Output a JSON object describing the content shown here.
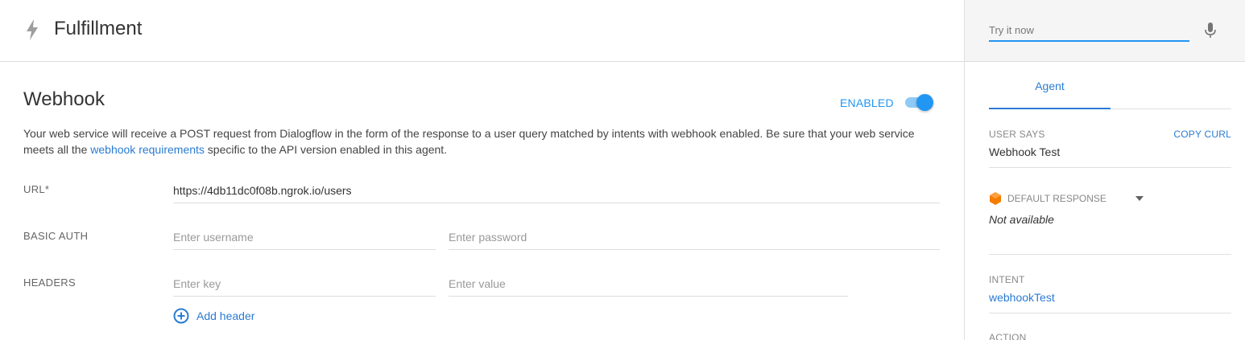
{
  "header": {
    "title": "Fulfillment"
  },
  "webhook": {
    "title": "Webhook",
    "enabled_label": "ENABLED",
    "enabled": true,
    "description_before": "Your web service will receive a POST request from Dialogflow in the form of the response to a user query matched by intents with webhook enabled. Be sure that your web service meets all the ",
    "description_link": "webhook requirements",
    "description_after": " specific to the API version enabled in this agent.",
    "url_label": "URL*",
    "url_value": "https://4db11dc0f08b.ngrok.io/users",
    "basic_auth_label": "BASIC AUTH",
    "username_placeholder": "Enter username",
    "password_placeholder": "Enter password",
    "headers_label": "HEADERS",
    "key_placeholder": "Enter key",
    "value_placeholder": "Enter value",
    "add_header_label": "Add header"
  },
  "console": {
    "try_placeholder": "Try it now",
    "tab_agent": "Agent",
    "user_says_label": "USER SAYS",
    "copy_curl": "COPY CURL",
    "user_says_value": "Webhook Test",
    "default_response_label": "DEFAULT RESPONSE",
    "default_response_value": "Not available",
    "intent_label": "INTENT",
    "intent_value": "webhookTest",
    "action_label": "ACTION"
  },
  "colors": {
    "accent": "#2196f3",
    "link": "#2a7bd3",
    "cube": "#f57c00"
  },
  "icons": [
    "bolt-icon",
    "mic-icon",
    "add-circle-icon",
    "cube-icon",
    "caret-down-icon"
  ]
}
